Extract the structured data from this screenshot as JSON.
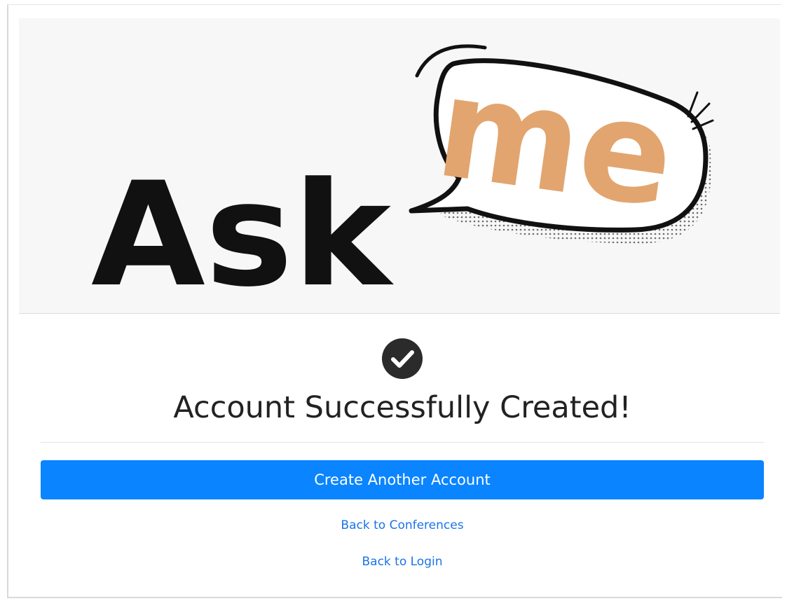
{
  "logo": {
    "word_ask": "Ask",
    "word_me": "me",
    "ask_color": "#111111",
    "me_color": "#e2a56f",
    "icon": "speech-bubble-icon"
  },
  "status": {
    "icon": "check-circle-icon",
    "title": "Account Successfully Created!"
  },
  "actions": {
    "create_another_label": "Create Another Account",
    "back_to_conferences_label": "Back to Conferences",
    "back_to_login_label": "Back to Login"
  },
  "colors": {
    "primary": "#0a84ff",
    "link": "#1a73e8",
    "panel_bg": "#f7f7f7",
    "text": "#222222"
  }
}
